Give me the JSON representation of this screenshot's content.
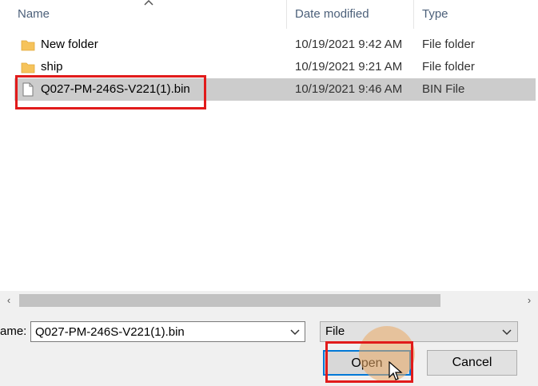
{
  "columns": {
    "name": "Name",
    "date_modified": "Date modified",
    "type": "Type"
  },
  "files": [
    {
      "name": "New folder",
      "date": "10/19/2021 9:42 AM",
      "type": "File folder",
      "icon": "folder-icon"
    },
    {
      "name": "ship",
      "date": "10/19/2021 9:21 AM",
      "type": "File folder",
      "icon": "folder-icon"
    },
    {
      "name": "Q027-PM-246S-V221(1).bin",
      "date": "10/19/2021 9:46 AM",
      "type": "BIN File",
      "icon": "file-icon",
      "selected": true
    }
  ],
  "file_name": {
    "label": "ame:",
    "value": "Q027-PM-246S-V221(1).bin"
  },
  "file_type_filter": "File",
  "buttons": {
    "open": "Open",
    "cancel": "Cancel"
  },
  "colors": {
    "highlight": "#e11b1b",
    "selection": "#cccccc",
    "folder": "#f6c35b",
    "focus_border": "#0078d7"
  }
}
